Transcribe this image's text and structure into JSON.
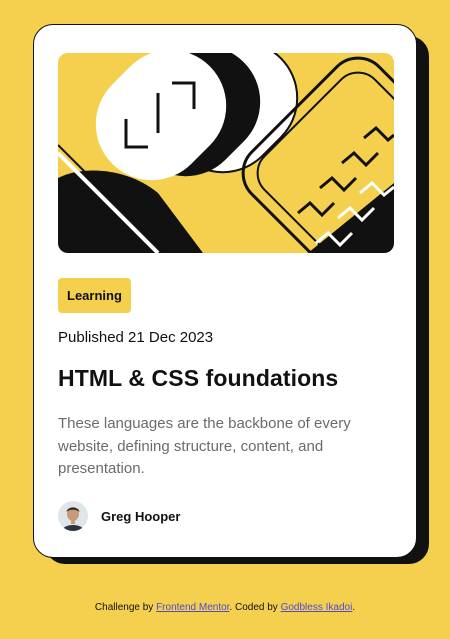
{
  "card": {
    "tag": "Learning",
    "published": "Published 21 Dec 2023",
    "title": "HTML & CSS foundations",
    "description": "These languages are the backbone of every website, defining structure, content, and presentation.",
    "author": "Greg Hooper"
  },
  "footer": {
    "prefix": "Challenge by ",
    "link1": "Frontend Mentor",
    "middle": ". Coded by ",
    "link2": "Godbless Ikadoi",
    "suffix": "."
  },
  "colors": {
    "background": "#f4d04e",
    "card": "#ffffff",
    "ink": "#111111",
    "muted": "#6b6b6b",
    "link": "#4e4bd0"
  },
  "icons": {
    "hero": "abstract-illustration",
    "avatar": "avatar-photo"
  }
}
